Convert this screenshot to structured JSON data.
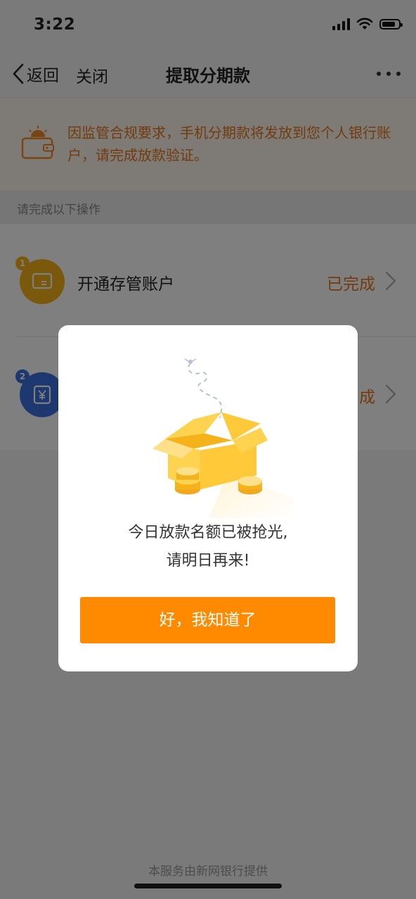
{
  "status_bar": {
    "time": "3:22"
  },
  "nav": {
    "back_label": "返回",
    "close_label": "关闭",
    "title": "提取分期款"
  },
  "notice": {
    "text": "因监管合规要求，手机分期款将发放到您个人银行账户，请完成放款验证。"
  },
  "section": {
    "header": "请完成以下操作"
  },
  "steps": [
    {
      "number": "1",
      "label": "开通存管账户",
      "status": "已完成",
      "icon": "wallet-card-icon",
      "color": "#f5b21b"
    },
    {
      "number": "2",
      "label": "",
      "status": "成",
      "icon": "yen-card-icon",
      "color": "#3b6fe0"
    }
  ],
  "footer": {
    "text": "本服务由新网银行提供"
  },
  "modal": {
    "line1": "今日放款名额已被抢光,",
    "line2": "请明日再来!",
    "button_label": "好，我知道了",
    "illustration": "empty-box-with-coins-icon"
  },
  "colors": {
    "accent": "#ff8a00",
    "notice_text": "#e5771a"
  }
}
